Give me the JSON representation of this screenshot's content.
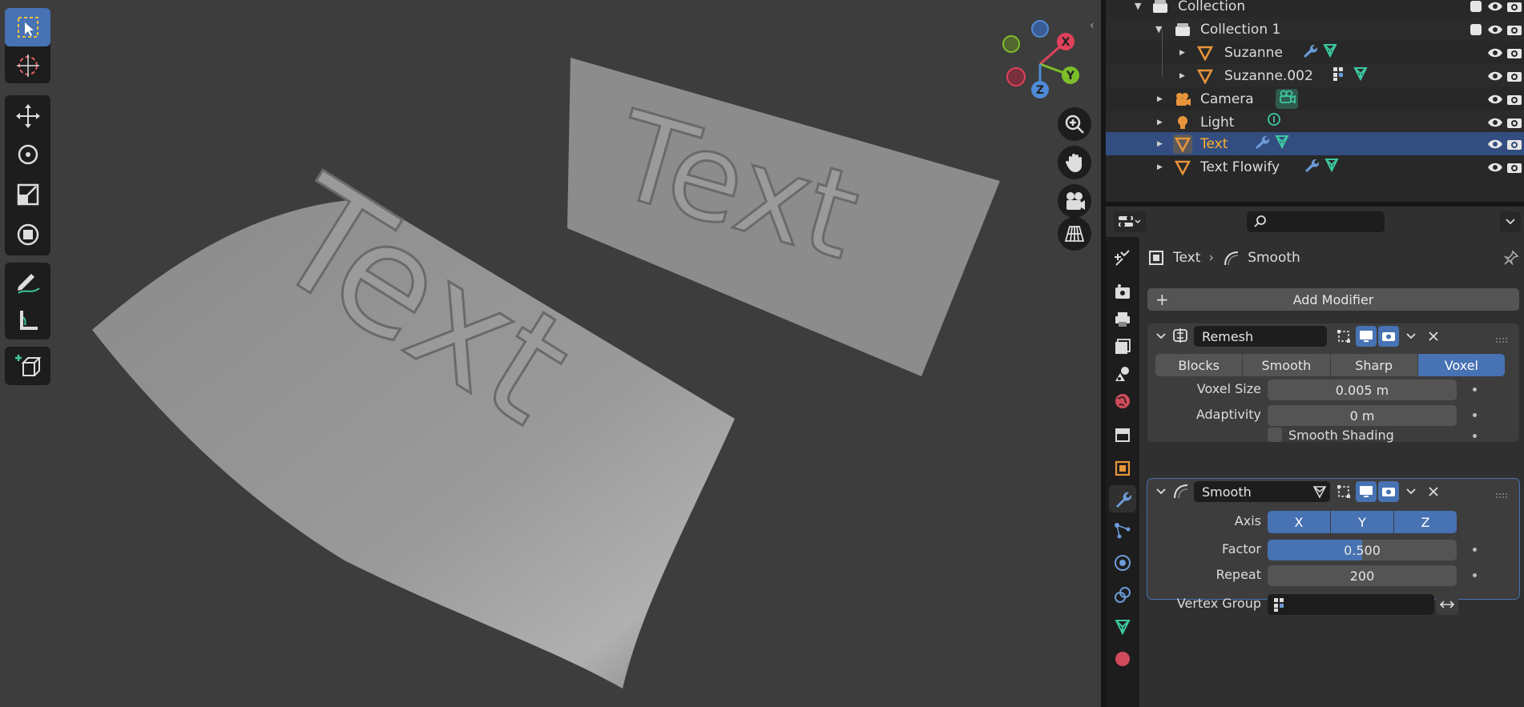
{
  "viewport": {
    "toolbar_tools": [
      "select-box-tool",
      "cursor-tool",
      "move-tool",
      "rotate-tool",
      "scale-tool",
      "transform-tool",
      "annotate-tool",
      "measure-tool",
      "add-cube-tool"
    ],
    "scene_text_1": "Text",
    "scene_text_2": "Text",
    "gizmo_x": "X",
    "gizmo_y": "Y",
    "gizmo_z": "Z"
  },
  "outliner": {
    "rows": [
      {
        "name": "Collection"
      },
      {
        "name": "Collection 1"
      },
      {
        "name": "Suzanne"
      },
      {
        "name": "Suzanne.002"
      },
      {
        "name": "Camera"
      },
      {
        "name": "Light"
      },
      {
        "name": "Text"
      },
      {
        "name": "Text Flowify"
      }
    ]
  },
  "properties": {
    "search_placeholder": "",
    "breadcrumb_object": "Text",
    "breadcrumb_modifier": "Smooth",
    "add_modifier_label": "Add Modifier",
    "remesh": {
      "name": "Remesh",
      "modes": [
        "Blocks",
        "Smooth",
        "Sharp",
        "Voxel"
      ],
      "active_mode": "Voxel",
      "voxel_size_label": "Voxel Size",
      "voxel_size_value": "0.005 m",
      "adaptivity_label": "Adaptivity",
      "adaptivity_value": "0 m",
      "smooth_shading_label": "Smooth Shading",
      "smooth_shading_checked": false
    },
    "smooth": {
      "name": "Smooth",
      "axis_label": "Axis",
      "axes": [
        "X",
        "Y",
        "Z"
      ],
      "factor_label": "Factor",
      "factor_value": "0.500",
      "factor_fraction": 0.5,
      "repeat_label": "Repeat",
      "repeat_value": "200",
      "vertex_group_label": "Vertex Group"
    }
  },
  "colors": {
    "accent": "#4772b3",
    "selected_text": "#ffaf29",
    "object_orange": "#e8953a",
    "modifier_blue": "#6c9bd8",
    "mesh_green": "#3dc8a0"
  }
}
